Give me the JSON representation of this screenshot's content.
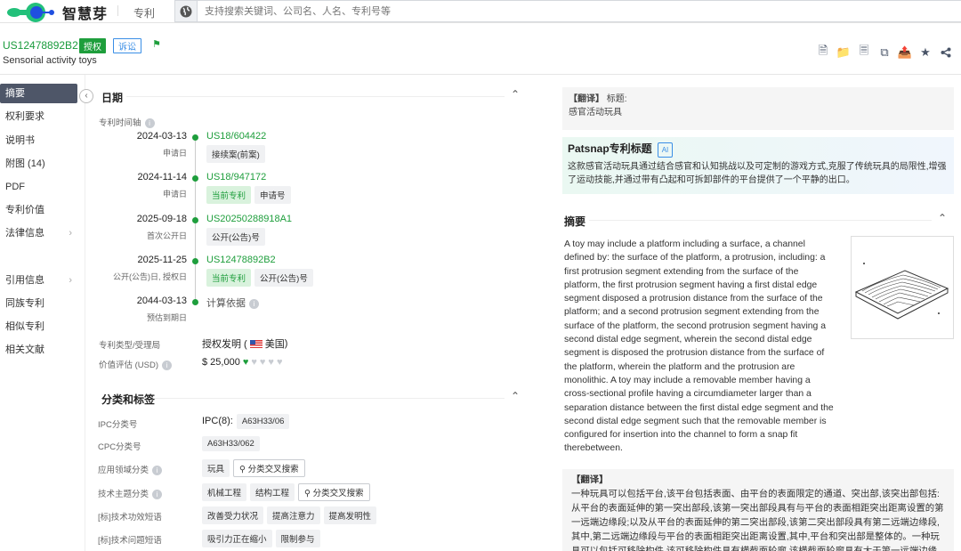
{
  "topbar": {
    "brand": "智慧芽",
    "nav_patent": "专利",
    "search_placeholder": "支持搜索关键词、公司名、人名、专利号等"
  },
  "header": {
    "patent_number": "US12478892B2",
    "status_badge": "授权",
    "litigation_badge": "诉讼",
    "title": "Sensorial activity toys",
    "actions": [
      "pdf-download-icon",
      "folder-icon",
      "export-icon",
      "copy-icon",
      "share-folder-icon",
      "star-icon",
      "share-icon"
    ]
  },
  "sidebar": {
    "items": [
      {
        "label": "摘要",
        "active": true
      },
      {
        "label": "权利要求"
      },
      {
        "label": "说明书"
      },
      {
        "label": "附图 (14)"
      },
      {
        "label": "PDF"
      },
      {
        "label": "专利价值"
      },
      {
        "label": "法律信息",
        "has_children": true
      },
      {
        "label": "引用信息",
        "has_children": true
      },
      {
        "label": "同族专利"
      },
      {
        "label": "相似专利"
      },
      {
        "label": "相关文献"
      }
    ]
  },
  "dates": {
    "section_title": "日期",
    "timeline_label": "专利时间轴",
    "timeline": [
      {
        "date": "2024-03-13",
        "sub": "申请日",
        "number": "US18/604422",
        "tags": [
          {
            "text": "接续案(前案)",
            "green": false
          }
        ]
      },
      {
        "date": "2024-11-14",
        "sub": "申请日",
        "number": "US18/947172",
        "tags": [
          {
            "text": "当前专利",
            "green": true
          },
          {
            "text": "申请号",
            "green": false
          }
        ]
      },
      {
        "date": "2025-09-18",
        "sub": "首次公开日",
        "number": "US20250288918A1",
        "tags": [
          {
            "text": "公开(公告)号",
            "green": false
          }
        ]
      },
      {
        "date": "2025-11-25",
        "sub": "公开(公告)日, 授权日",
        "number": "US12478892B2",
        "tags": [
          {
            "text": "当前专利",
            "green": true
          },
          {
            "text": "公开(公告)号",
            "green": false
          }
        ]
      },
      {
        "date": "2044-03-13",
        "sub": "预估到期日",
        "calc_basis": "计算依据"
      }
    ],
    "type_label": "专利类型/受理局",
    "type_value": "授权发明 (",
    "country": "美国",
    "type_close": ")",
    "value_label": "价值评估 (USD)",
    "value": "$ 25,000",
    "value_rating": 1,
    "value_rating_max": 5
  },
  "classification": {
    "section_title": "分类和标签",
    "rows": [
      {
        "label": "IPC分类号",
        "prefix": "IPC(8):",
        "tags": [
          "A63H33/06"
        ]
      },
      {
        "label": "CPC分类号",
        "tags": [
          "A63H33/062"
        ]
      },
      {
        "label": "应用领域分类",
        "info": true,
        "tags": [
          "玩具"
        ],
        "search": "分类交叉搜索"
      },
      {
        "label": "技术主题分类",
        "info": true,
        "tags": [
          "机械工程",
          "结构工程"
        ],
        "search": "分类交叉搜索"
      },
      {
        "label": "[标]技术功效短语",
        "tags": [
          "改善受力状况",
          "提高注意力",
          "提高发明性"
        ]
      },
      {
        "label": "[标]技术问题短语",
        "tags": [
          "吸引力正在缩小",
          "限制参与"
        ]
      }
    ]
  },
  "right": {
    "title_translation": {
      "label": "【翻译】",
      "field": "标题:",
      "text": "感官活动玩具"
    },
    "ai_title": {
      "title": "Patsnap专利标题",
      "badge": "AI",
      "text": "这款感官活动玩具通过结合感官和认知挑战以及可定制的游戏方式,克服了传统玩具的局限性,增强了运动技能,并通过带有凸起和可拆卸部件的平台提供了一个平静的出口。"
    },
    "abstract": {
      "title": "摘要",
      "text": "A toy may include a platform including a surface, a channel defined by: the surface of the platform, a protrusion, including: a first protrusion segment extending from the surface of the platform, the first protrusion segment having a first distal edge segment disposed a protrusion distance from the surface of the platform; and a second protrusion segment extending from the surface of the platform, the second protrusion segment having a second distal edge segment, wherein the second distal edge segment is disposed the protrusion distance from the surface of the platform, wherein the platform and the protrusion are monolithic. A toy may include a removable member having a cross-sectional profile having a circumdiameter larger than a separation distance between the first distal edge segment and the second distal edge segment such that the removable member is configured for insertion into the channel to form a snap fit therebetween."
    },
    "abstract_translation": {
      "label": "【翻译】",
      "text": "一种玩具可以包括平台,该平台包括表面、由平台的表面限定的通道、突出部,该突出部包括:从平台的表面延伸的第一突出部段,该第一突出部段具有与平台的表面相距突出距离设置的第一远端边缘段;以及从平台的表面延伸的第二突出部段,该第二突出部段具有第二远端边缘段,其中,第二远端边缘段与平台的表面相距突出距离设置,其中,平台和突出部是整体的。一种玩具可以包括可移除构件,该可移除构件具有横截面轮廓,该横截面轮廓具有大于第一远端边缘"
    }
  },
  "colors": {
    "brand_green": "#1e9e3c",
    "accent_blue": "#3a8ee6",
    "sidebar_active": "#4e5668"
  }
}
